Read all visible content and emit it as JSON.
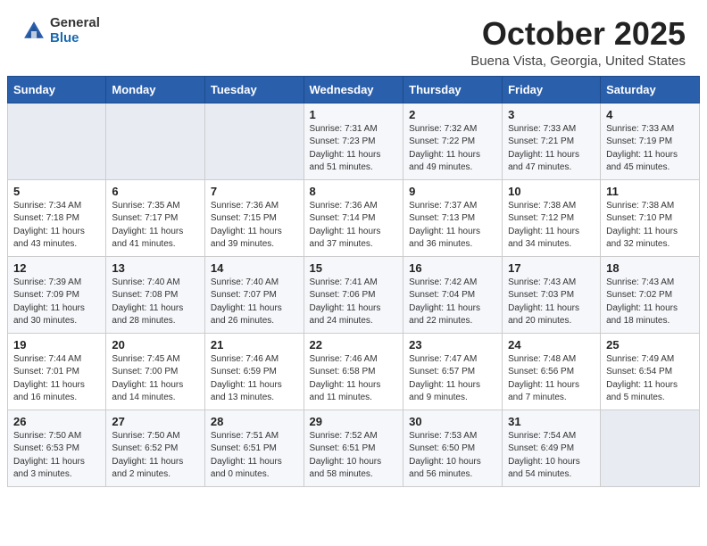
{
  "header": {
    "logo_general": "General",
    "logo_blue": "Blue",
    "month_title": "October 2025",
    "location": "Buena Vista, Georgia, United States"
  },
  "weekdays": [
    "Sunday",
    "Monday",
    "Tuesday",
    "Wednesday",
    "Thursday",
    "Friday",
    "Saturday"
  ],
  "weeks": [
    [
      {
        "day": "",
        "info": ""
      },
      {
        "day": "",
        "info": ""
      },
      {
        "day": "",
        "info": ""
      },
      {
        "day": "1",
        "info": "Sunrise: 7:31 AM\nSunset: 7:23 PM\nDaylight: 11 hours\nand 51 minutes."
      },
      {
        "day": "2",
        "info": "Sunrise: 7:32 AM\nSunset: 7:22 PM\nDaylight: 11 hours\nand 49 minutes."
      },
      {
        "day": "3",
        "info": "Sunrise: 7:33 AM\nSunset: 7:21 PM\nDaylight: 11 hours\nand 47 minutes."
      },
      {
        "day": "4",
        "info": "Sunrise: 7:33 AM\nSunset: 7:19 PM\nDaylight: 11 hours\nand 45 minutes."
      }
    ],
    [
      {
        "day": "5",
        "info": "Sunrise: 7:34 AM\nSunset: 7:18 PM\nDaylight: 11 hours\nand 43 minutes."
      },
      {
        "day": "6",
        "info": "Sunrise: 7:35 AM\nSunset: 7:17 PM\nDaylight: 11 hours\nand 41 minutes."
      },
      {
        "day": "7",
        "info": "Sunrise: 7:36 AM\nSunset: 7:15 PM\nDaylight: 11 hours\nand 39 minutes."
      },
      {
        "day": "8",
        "info": "Sunrise: 7:36 AM\nSunset: 7:14 PM\nDaylight: 11 hours\nand 37 minutes."
      },
      {
        "day": "9",
        "info": "Sunrise: 7:37 AM\nSunset: 7:13 PM\nDaylight: 11 hours\nand 36 minutes."
      },
      {
        "day": "10",
        "info": "Sunrise: 7:38 AM\nSunset: 7:12 PM\nDaylight: 11 hours\nand 34 minutes."
      },
      {
        "day": "11",
        "info": "Sunrise: 7:38 AM\nSunset: 7:10 PM\nDaylight: 11 hours\nand 32 minutes."
      }
    ],
    [
      {
        "day": "12",
        "info": "Sunrise: 7:39 AM\nSunset: 7:09 PM\nDaylight: 11 hours\nand 30 minutes."
      },
      {
        "day": "13",
        "info": "Sunrise: 7:40 AM\nSunset: 7:08 PM\nDaylight: 11 hours\nand 28 minutes."
      },
      {
        "day": "14",
        "info": "Sunrise: 7:40 AM\nSunset: 7:07 PM\nDaylight: 11 hours\nand 26 minutes."
      },
      {
        "day": "15",
        "info": "Sunrise: 7:41 AM\nSunset: 7:06 PM\nDaylight: 11 hours\nand 24 minutes."
      },
      {
        "day": "16",
        "info": "Sunrise: 7:42 AM\nSunset: 7:04 PM\nDaylight: 11 hours\nand 22 minutes."
      },
      {
        "day": "17",
        "info": "Sunrise: 7:43 AM\nSunset: 7:03 PM\nDaylight: 11 hours\nand 20 minutes."
      },
      {
        "day": "18",
        "info": "Sunrise: 7:43 AM\nSunset: 7:02 PM\nDaylight: 11 hours\nand 18 minutes."
      }
    ],
    [
      {
        "day": "19",
        "info": "Sunrise: 7:44 AM\nSunset: 7:01 PM\nDaylight: 11 hours\nand 16 minutes."
      },
      {
        "day": "20",
        "info": "Sunrise: 7:45 AM\nSunset: 7:00 PM\nDaylight: 11 hours\nand 14 minutes."
      },
      {
        "day": "21",
        "info": "Sunrise: 7:46 AM\nSunset: 6:59 PM\nDaylight: 11 hours\nand 13 minutes."
      },
      {
        "day": "22",
        "info": "Sunrise: 7:46 AM\nSunset: 6:58 PM\nDaylight: 11 hours\nand 11 minutes."
      },
      {
        "day": "23",
        "info": "Sunrise: 7:47 AM\nSunset: 6:57 PM\nDaylight: 11 hours\nand 9 minutes."
      },
      {
        "day": "24",
        "info": "Sunrise: 7:48 AM\nSunset: 6:56 PM\nDaylight: 11 hours\nand 7 minutes."
      },
      {
        "day": "25",
        "info": "Sunrise: 7:49 AM\nSunset: 6:54 PM\nDaylight: 11 hours\nand 5 minutes."
      }
    ],
    [
      {
        "day": "26",
        "info": "Sunrise: 7:50 AM\nSunset: 6:53 PM\nDaylight: 11 hours\nand 3 minutes."
      },
      {
        "day": "27",
        "info": "Sunrise: 7:50 AM\nSunset: 6:52 PM\nDaylight: 11 hours\nand 2 minutes."
      },
      {
        "day": "28",
        "info": "Sunrise: 7:51 AM\nSunset: 6:51 PM\nDaylight: 11 hours\nand 0 minutes."
      },
      {
        "day": "29",
        "info": "Sunrise: 7:52 AM\nSunset: 6:51 PM\nDaylight: 10 hours\nand 58 minutes."
      },
      {
        "day": "30",
        "info": "Sunrise: 7:53 AM\nSunset: 6:50 PM\nDaylight: 10 hours\nand 56 minutes."
      },
      {
        "day": "31",
        "info": "Sunrise: 7:54 AM\nSunset: 6:49 PM\nDaylight: 10 hours\nand 54 minutes."
      },
      {
        "day": "",
        "info": ""
      }
    ]
  ]
}
